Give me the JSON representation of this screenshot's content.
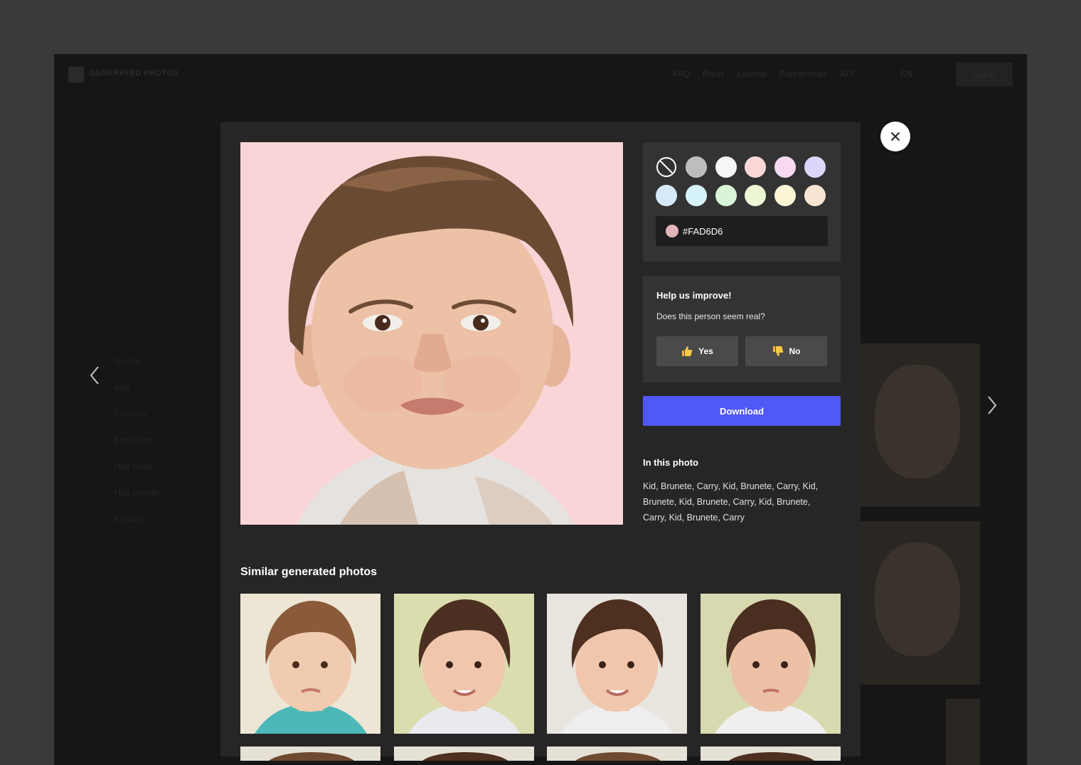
{
  "background_page": {
    "brand": "GENERATED PHOTOS",
    "nav_links": [
      "FAQ",
      "Press",
      "License",
      "Partnerships",
      "API"
    ],
    "language": "EN",
    "sign_in": "Sign in",
    "filters": [
      "Gender",
      "Age",
      "Ethnicity",
      "Eye Color",
      "Hair Color",
      "Hair Length",
      "Emotion"
    ]
  },
  "modal": {
    "main_photo_background": "#FAD6D6",
    "swatches": [
      {
        "name": "none",
        "color": "transparent"
      },
      {
        "name": "gray",
        "color": "#BDBDBD"
      },
      {
        "name": "white",
        "color": "#F6F6F6"
      },
      {
        "name": "pink",
        "color": "#FAD6D6"
      },
      {
        "name": "light-pink",
        "color": "#F8D9F2"
      },
      {
        "name": "lavender",
        "color": "#DED6FA"
      },
      {
        "name": "light-blue",
        "color": "#D6E9FA"
      },
      {
        "name": "cyan",
        "color": "#D6F3FA"
      },
      {
        "name": "mint",
        "color": "#D8F5D8"
      },
      {
        "name": "lime",
        "color": "#EDF6D3"
      },
      {
        "name": "cream",
        "color": "#FBF5D3"
      },
      {
        "name": "peach",
        "color": "#F8E4D2"
      }
    ],
    "hex_value": "#FAD6D6",
    "hex_display": "#FAD6D6",
    "feedback": {
      "title": "Help us improve!",
      "question": "Does this person seem real?",
      "yes_label": "Yes",
      "no_label": "No"
    },
    "download_label": "Download",
    "in_this_photo_title": "In this photo",
    "tags_text": "Kid, Brunete, Carry, Kid, Brunete, Carry, Kid, Brunete, Kid, Brunete, Carry, Kid, Brunete, Carry, Kid, Brunete, Carry",
    "similar_title": "Similar generated photos",
    "similar_photos": [
      {
        "name": "similar-photo-1",
        "bg": "#EDE6D5",
        "shirt": "#4DB8B8"
      },
      {
        "name": "similar-photo-2",
        "bg": "#DCDDAE",
        "shirt": "#E9EAEE"
      },
      {
        "name": "similar-photo-3",
        "bg": "#E8E4DE",
        "shirt": "#EEEEEE"
      },
      {
        "name": "similar-photo-4",
        "bg": "#D9D9B0",
        "shirt": "#EFEFEF"
      }
    ]
  }
}
